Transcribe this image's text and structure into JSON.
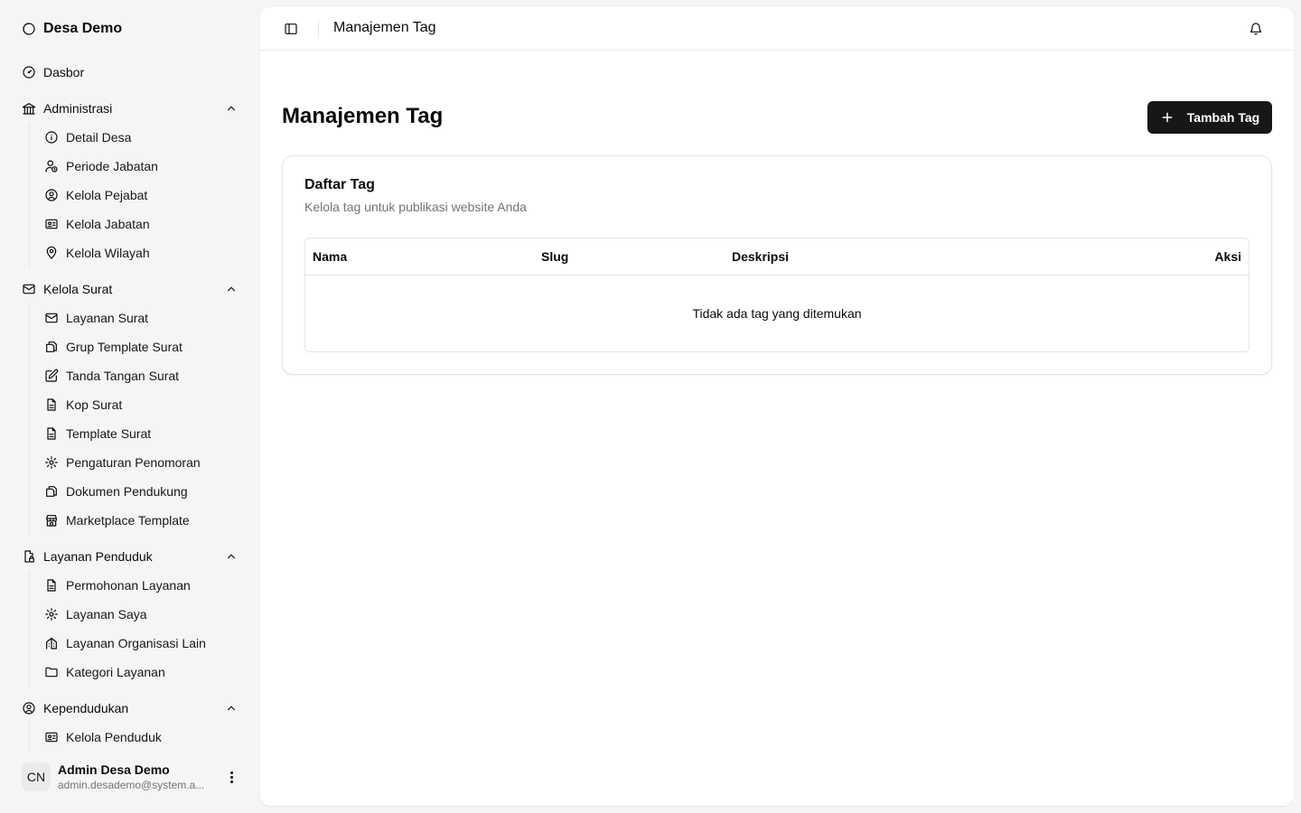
{
  "app": {
    "name": "Desa Demo"
  },
  "sidebar": {
    "dashboard": {
      "label": "Dasbor"
    },
    "groups": [
      {
        "label": "Administrasi",
        "items": [
          {
            "label": "Detail Desa"
          },
          {
            "label": "Periode Jabatan"
          },
          {
            "label": "Kelola Pejabat"
          },
          {
            "label": "Kelola Jabatan"
          },
          {
            "label": "Kelola Wilayah"
          }
        ]
      },
      {
        "label": "Kelola Surat",
        "items": [
          {
            "label": "Layanan Surat"
          },
          {
            "label": "Grup Template Surat"
          },
          {
            "label": "Tanda Tangan Surat"
          },
          {
            "label": "Kop Surat"
          },
          {
            "label": "Template Surat"
          },
          {
            "label": "Pengaturan Penomoran"
          },
          {
            "label": "Dokumen Pendukung"
          },
          {
            "label": "Marketplace Template"
          }
        ]
      },
      {
        "label": "Layanan Penduduk",
        "items": [
          {
            "label": "Permohonan Layanan"
          },
          {
            "label": "Layanan Saya"
          },
          {
            "label": "Layanan Organisasi Lain"
          },
          {
            "label": "Kategori Layanan"
          }
        ]
      },
      {
        "label": "Kependudukan",
        "items": [
          {
            "label": "Kelola Penduduk"
          }
        ]
      }
    ],
    "user": {
      "initials": "CN",
      "name": "Admin Desa Demo",
      "email": "admin.desademo@system.a..."
    }
  },
  "header": {
    "title": "Manajemen Tag"
  },
  "main": {
    "title": "Manajemen Tag",
    "add_button": "Tambah Tag",
    "card": {
      "title": "Daftar Tag",
      "description": "Kelola tag untuk publikasi website Anda",
      "columns": [
        "Nama",
        "Slug",
        "Deskripsi",
        "Aksi"
      ],
      "empty_text": "Tidak ada tag yang ditemukan"
    }
  }
}
